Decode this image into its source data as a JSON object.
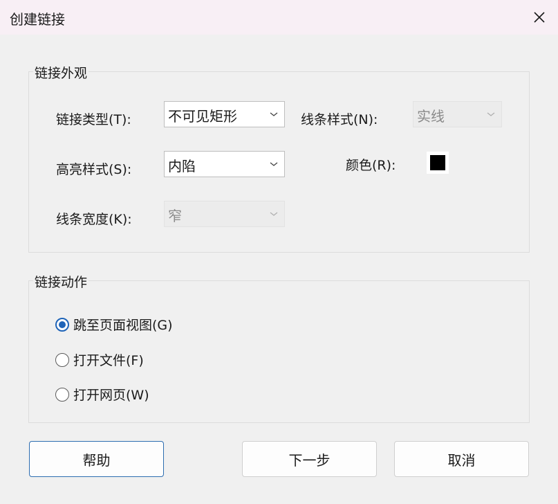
{
  "window": {
    "title": "创建链接",
    "close_icon": "close-icon"
  },
  "appearance": {
    "group_label": "链接外观",
    "link_type": {
      "label": "链接类型(T):",
      "value": "不可见矩形"
    },
    "line_style": {
      "label": "线条样式(N):",
      "value": "实线",
      "disabled": true
    },
    "highlight_style": {
      "label": "高亮样式(S):",
      "value": "内陷"
    },
    "color": {
      "label": "颜色(R):",
      "swatch": "#000000"
    },
    "line_width": {
      "label": "线条宽度(K):",
      "value": "窄",
      "disabled": true
    }
  },
  "action": {
    "group_label": "链接动作",
    "options": [
      {
        "label": "跳至页面视图(G)",
        "checked": true
      },
      {
        "label": "打开文件(F)",
        "checked": false
      },
      {
        "label": "打开网页(W)",
        "checked": false
      }
    ]
  },
  "buttons": {
    "help": "帮助",
    "next": "下一步",
    "cancel": "取消"
  },
  "colors": {
    "accent": "#1f64b8",
    "titlebar_bg": "#f8eff5"
  }
}
